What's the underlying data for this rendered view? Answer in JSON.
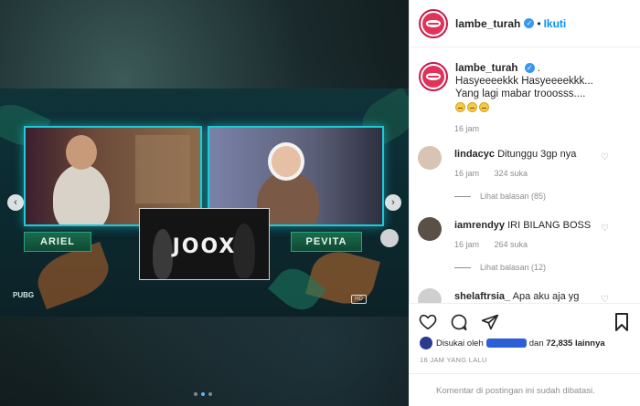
{
  "post": {
    "username": "lambe_turah",
    "follow_label": "Ikuti",
    "separator": "•",
    "caption_lines": [
      "Hasyeeeekkk Hasyeeeekkk...",
      "Yang lagi mabar trooosss...."
    ],
    "caption_dot": ".",
    "caption_time": "16 jam"
  },
  "media": {
    "left_name": "ARIEL",
    "right_name": "PEVITA",
    "center_logo": "JOOX",
    "corner_logo": "PUBG",
    "hd_badge": "HD",
    "prev_arrow": "‹",
    "next_arrow": "›",
    "slide_count": 3,
    "active_slide": 1
  },
  "comments": [
    {
      "user": "lindacyc",
      "text": "Ditunggu 3gp nya",
      "time": "16 jam",
      "likes": "324 suka",
      "replies": "Lihat balasan (85)"
    },
    {
      "user": "iamrendyy",
      "text": "IRI BILANG BOSS",
      "time": "16 jam",
      "likes": "264 suka",
      "replies": "Lihat balasan (12)"
    },
    {
      "user": "shelaftrsia_",
      "text": "Apa aku aja yg salah"
    }
  ],
  "footer": {
    "liked_prefix": "Disukai oleh",
    "liked_suffix_connector": "dan",
    "liked_count": "72,835 lainnya",
    "post_date": "16 JAM YANG LALU",
    "comments_disabled": "Komentar di postingan ini sudah dibatasi."
  },
  "icons": [
    "heart-icon",
    "comment-icon",
    "share-icon",
    "bookmark-icon",
    "verified-icon"
  ],
  "colors": {
    "accent": "#0095f6",
    "verified": "#3897f0",
    "brand": "#e0335a",
    "frame_glow": "#1fc9d6"
  }
}
